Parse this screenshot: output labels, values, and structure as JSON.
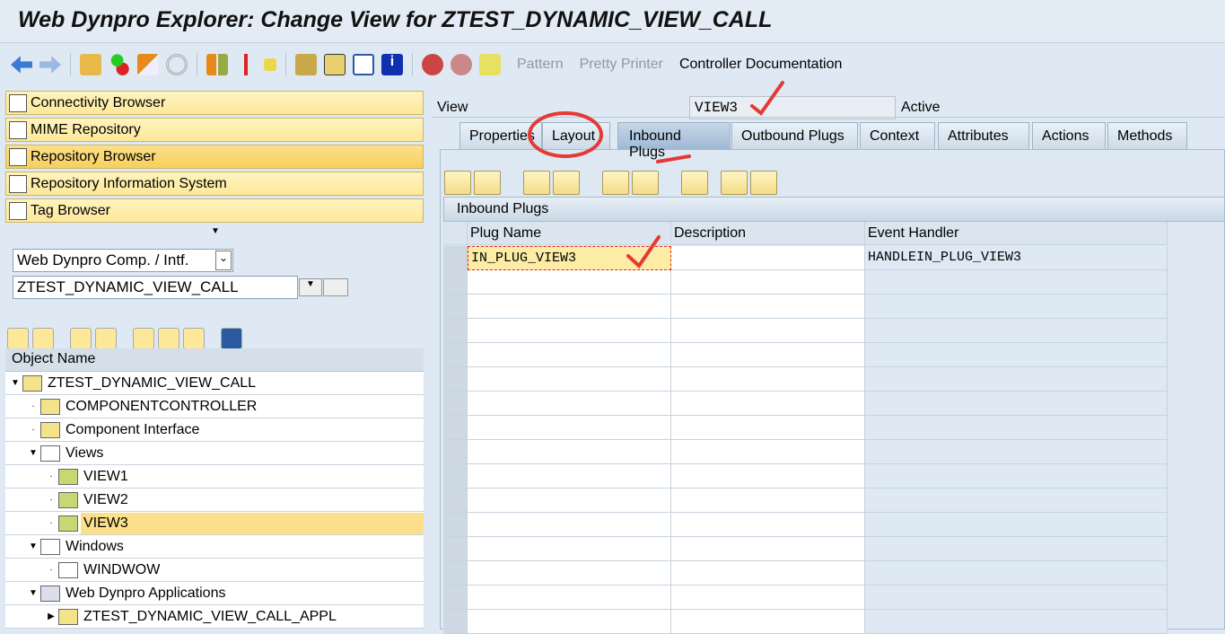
{
  "title": "Web Dynpro Explorer: Change View for ZTEST_DYNAMIC_VIEW_CALL",
  "toolbar": {
    "pattern": "Pattern",
    "pretty_printer": "Pretty Printer",
    "controller_doc": "Controller Documentation"
  },
  "nav": [
    {
      "label": "Connectivity Browser"
    },
    {
      "label": "MIME Repository"
    },
    {
      "label": "Repository Browser"
    },
    {
      "label": "Repository Information System"
    },
    {
      "label": "Tag Browser"
    }
  ],
  "object_type": "Web Dynpro Comp. / Intf.",
  "object_name": "ZTEST_DYNAMIC_VIEW_CALL",
  "tree": {
    "header": "Object Name",
    "rows": [
      {
        "label": "ZTEST_DYNAMIC_VIEW_CALL"
      },
      {
        "label": "COMPONENTCONTROLLER"
      },
      {
        "label": "Component Interface"
      },
      {
        "label": "Views"
      },
      {
        "label": "VIEW1"
      },
      {
        "label": "VIEW2"
      },
      {
        "label": "VIEW3"
      },
      {
        "label": "Windows"
      },
      {
        "label": "WINDWOW"
      },
      {
        "label": "Web Dynpro Applications"
      },
      {
        "label": "ZTEST_DYNAMIC_VIEW_CALL_APPL"
      }
    ]
  },
  "view": {
    "label": "View",
    "value": "VIEW3",
    "status": "Active"
  },
  "tabs": [
    "Properties",
    "Layout",
    "Inbound Plugs",
    "Outbound Plugs",
    "Context",
    "Attributes",
    "Actions",
    "Methods"
  ],
  "table": {
    "title": "Inbound Plugs",
    "columns": [
      "Plug Name",
      "Description",
      "Event Handler"
    ],
    "rows": [
      {
        "plug": "IN_PLUG_VIEW3",
        "description": "",
        "handler": "HANDLEIN_PLUG_VIEW3"
      }
    ]
  }
}
